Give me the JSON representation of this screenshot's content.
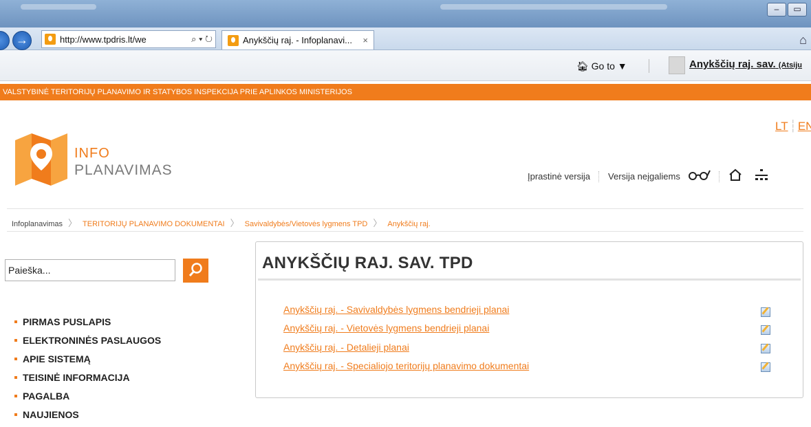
{
  "browser": {
    "url": "http://www.tpdris.lt/we",
    "tab_title": "Anykščių raj. - Infoplanavi...",
    "tab_close": "×",
    "address_tools": "⌕ ▾ ↻",
    "goto_label": "Go to ▼",
    "user_name": "Anykščių raj. sav.",
    "user_suffix": "(Atsiju"
  },
  "header": {
    "ministry": "VALSTYBINĖ TERITORIJŲ PLANAVIMO IR STATYBOS INSPEKCIJA PRIE APLINKOS MINISTERIJOS",
    "logo_top": "INFO",
    "logo_bottom": "PLANAVIMAS",
    "lang_lt": "LT",
    "lang_en": "EN",
    "normal_version": "Įprastinė versija",
    "accessible_version": "Versija neįgaliems"
  },
  "breadcrumb": {
    "items": [
      "Infoplanavimas",
      "TERITORIJŲ PLANAVIMO DOKUMENTAI",
      "Savivaldybės/Vietovės lygmens TPD",
      "Anykščių raj."
    ]
  },
  "search": {
    "placeholder": "Paieška..."
  },
  "nav": {
    "items": [
      "PIRMAS PUSLAPIS",
      "ELEKTRONINĖS PASLAUGOS",
      "APIE SISTEMĄ",
      "TEISINĖ INFORMACIJA",
      "PAGALBA",
      "NAUJIENOS"
    ]
  },
  "content": {
    "title": "ANYKŠČIŲ RAJ. SAV. TPD",
    "links": [
      "Anykščių raj. - Savivaldybės lygmens bendrieji planai",
      "Anykščių raj. - Vietovės lygmens bendrieji planai",
      "Anykščių raj. - Detalieji planai",
      "Anykščių raj. - Specialiojo teritorijų planavimo dokumentai"
    ]
  },
  "colors": {
    "accent": "#f07c1c",
    "text": "#333333"
  }
}
